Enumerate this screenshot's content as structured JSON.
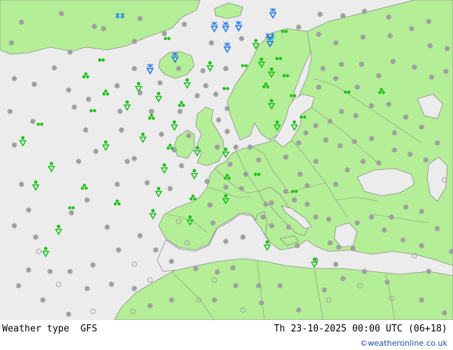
{
  "footer": {
    "title": "Weather type  GFS",
    "time": "Th 23-10-2025 00:00 UTC (06+18)",
    "credit": "©weatheronline.co.uk"
  },
  "colors": {
    "sea": "#ececec",
    "land": "#b4ee96",
    "border": "#8c8c8c",
    "rain": "#18c018",
    "snow": "#1e78e6",
    "cloud": "#a0a0a0"
  },
  "legend_icons": [
    "cloudy-dot",
    "partly-cloudy-circle",
    "light-rain-drops",
    "showers-icon",
    "snow-showers-icon",
    "thunderstorm-clover-icon"
  ]
}
